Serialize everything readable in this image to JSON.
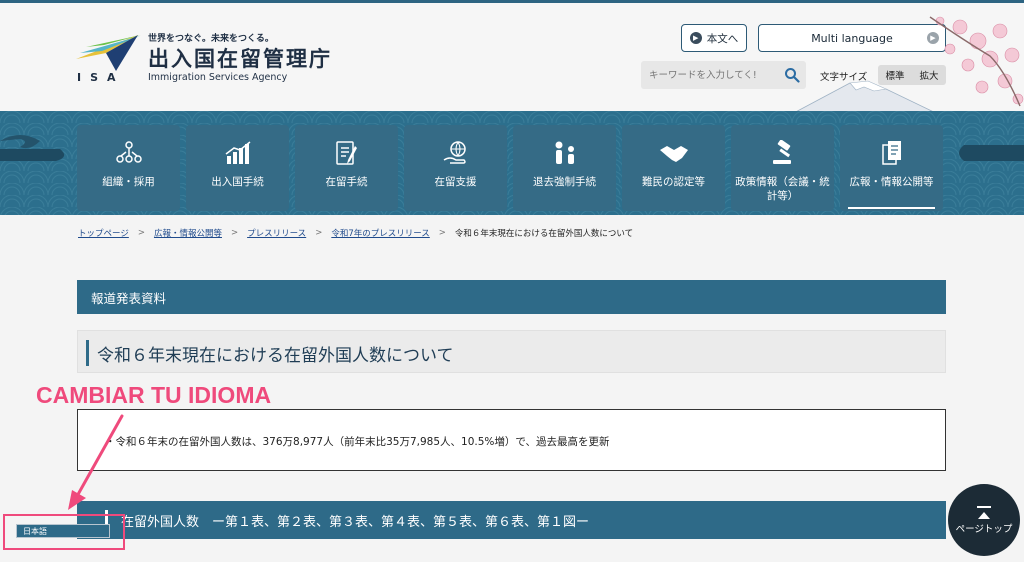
{
  "header": {
    "logo_tagline": "世界をつなぐ。未来をつくる。",
    "logo_name": "出入国在留管理庁",
    "logo_english": "Immigration Services Agency",
    "logo_abbr": "ISA",
    "skip_button_label": "本文へ",
    "language_button_label": "Multi language",
    "search_placeholder": "キーワードを入力してく!",
    "search_icon": "search-icon",
    "font_size_label": "文字サイズ",
    "font_size_options": [
      "標準",
      "拡大"
    ]
  },
  "nav": {
    "items": [
      {
        "label": "組織・採用",
        "icon": "organization-icon"
      },
      {
        "label": "出入国手続",
        "icon": "chart-icon"
      },
      {
        "label": "在留手続",
        "icon": "document-pen-icon"
      },
      {
        "label": "在留支援",
        "icon": "globe-hand-icon"
      },
      {
        "label": "退去強制手続",
        "icon": "people-icon"
      },
      {
        "label": "難民の認定等",
        "icon": "handshake-icon"
      },
      {
        "label": "政策情報（会議・統計等）",
        "icon": "gavel-icon"
      },
      {
        "label": "広報・情報公開等",
        "icon": "documents-icon",
        "active": true
      }
    ]
  },
  "breadcrumb": {
    "items": [
      "トップページ",
      "広報・情報公開等",
      "プレスリリース",
      "令和7年のプレスリリース"
    ],
    "current": "令和６年末現在における在留外国人数について"
  },
  "main": {
    "section_label": "報道発表資料",
    "title": "令和６年末現在における在留外国人数について",
    "summary": "・令和６年末の在留外国人数は、376万8,977人（前年末比35万7,985人、10.5%増）で、過去最高を更新",
    "subheading": "在留外国人数　ー第１表、第２表、第３表、第４表、第５表、第６表、第１図ー"
  },
  "annotation": {
    "text": "CAMBIAR TU IDIOMA",
    "color": "#ef4a7c"
  },
  "language_select": {
    "value": "日本語"
  },
  "page_top": {
    "label": "ページトップ"
  },
  "colors": {
    "primary": "#2e6a88",
    "nav_band": "#2c6f8d",
    "annotation": "#ef4a7c"
  }
}
